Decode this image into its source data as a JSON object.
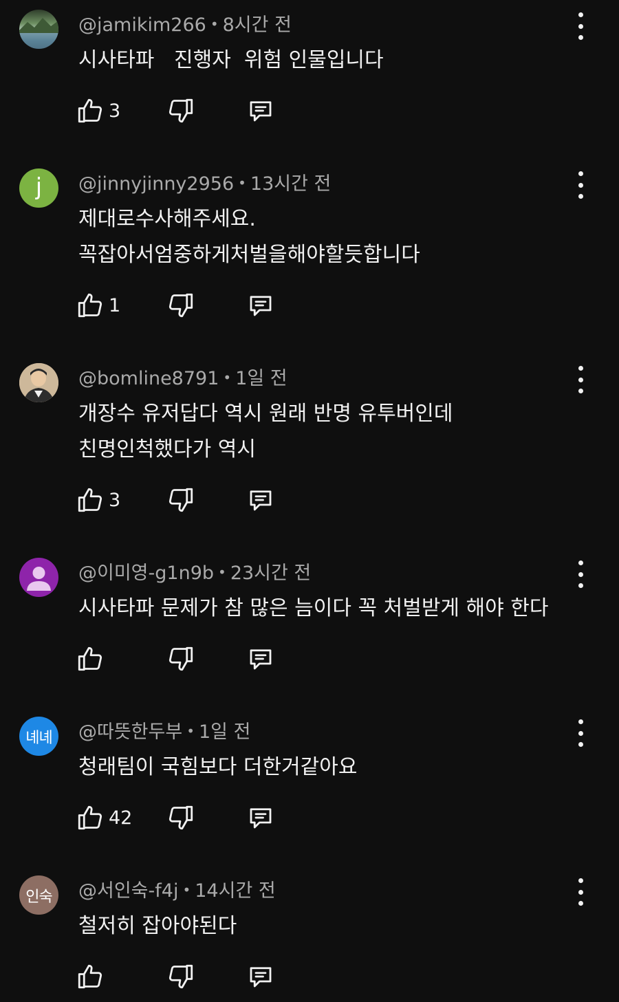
{
  "comments": [
    {
      "handle": "@jamikim266",
      "time": "8시간 전",
      "lines": [
        "시사타파   진행자  위험 인물입니다"
      ],
      "likes": "3",
      "avatar": {
        "type": "photo",
        "desc": "landscape",
        "colors": [
          "#6b8a6a",
          "#c9d4c4",
          "#3c5a73"
        ]
      }
    },
    {
      "handle": "@jinnyjinny2956",
      "time": "13시간 전",
      "lines": [
        "제대로수사해주세요.",
        "꼭잡아서엄중하게처벌을해야할듯합니다"
      ],
      "likes": "1",
      "avatar": {
        "type": "initial",
        "text": "j",
        "color": "#7cb342"
      }
    },
    {
      "handle": "@bomline8791",
      "time": "1일 전",
      "lines": [
        "개장수 유저답다 역시 원래 반명 유투버인데",
        "친명인척했다가 역시"
      ],
      "likes": "3",
      "avatar": {
        "type": "photo",
        "desc": "person",
        "colors": [
          "#d9c6a8",
          "#2b2b2b",
          "#e8d5b5"
        ]
      }
    },
    {
      "handle": "@이미영-g1n9b",
      "time": "23시간 전",
      "lines": [
        "시사타파 문제가 참 많은 늠이다 꼭 처벌받게 해야 한다"
      ],
      "likes": "",
      "avatar": {
        "type": "default",
        "color": "#8e24aa"
      }
    },
    {
      "handle": "@따뜻한두부",
      "time": "1일 전",
      "lines": [
        "청래팀이 국힘보다 더한거같아요"
      ],
      "likes": "42",
      "avatar": {
        "type": "text",
        "text": "녜녜",
        "color": "#1e88e5"
      }
    },
    {
      "handle": "@서인숙-f4j",
      "time": "14시간 전",
      "lines": [
        "철저히 잡아야된다"
      ],
      "likes": "",
      "avatar": {
        "type": "text",
        "text": "인숙",
        "color": "#8d6e63"
      }
    }
  ],
  "icons": {
    "like": "thumbs-up-icon",
    "dislike": "thumbs-down-icon",
    "reply": "reply-comment-icon",
    "more": "more-vertical-icon"
  }
}
